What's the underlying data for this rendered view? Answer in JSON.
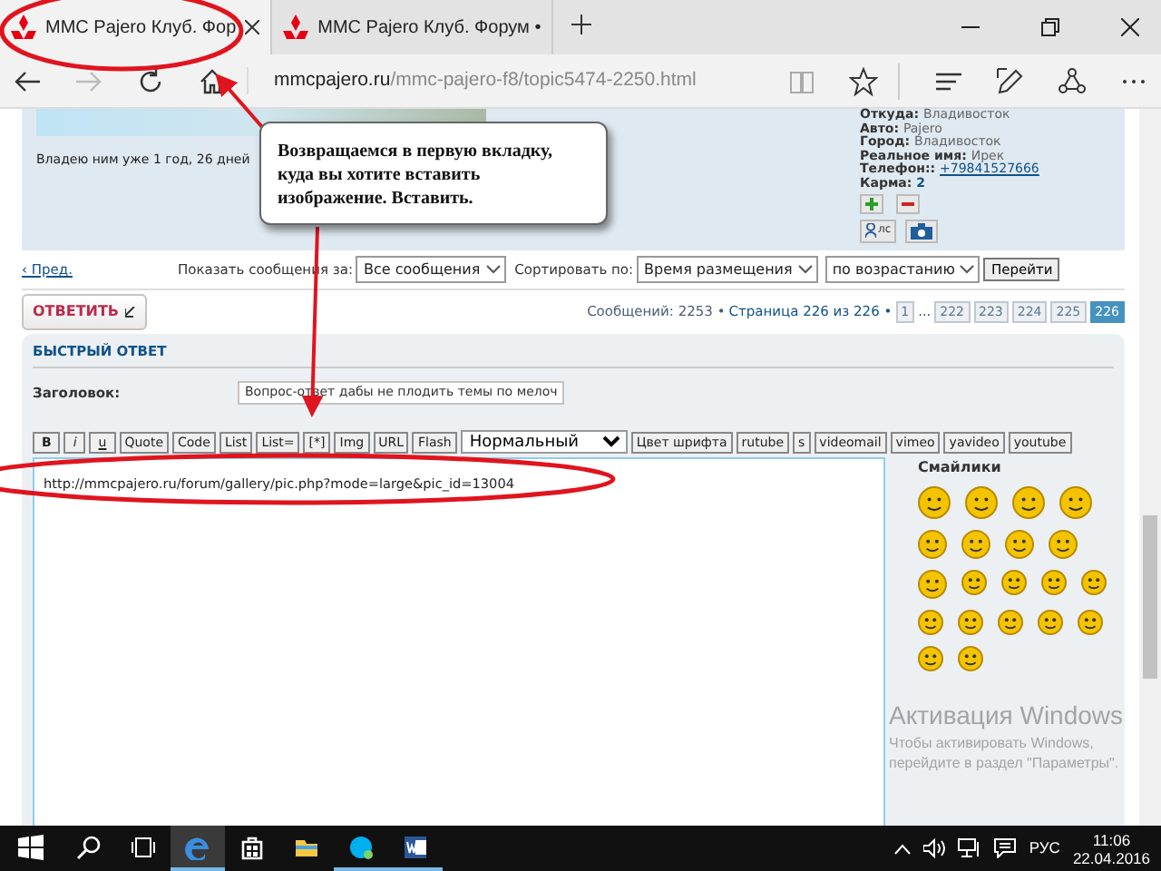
{
  "browser": {
    "tabs": [
      {
        "title": "MMC Pajero Клуб. Фор",
        "selected": true
      },
      {
        "title": "MMC Pajero Клуб. Форум •",
        "selected": false
      }
    ],
    "address": {
      "domain": "mmcpajero.ru",
      "path": "/mmc-pajero-f8/topic5474-2250.html"
    },
    "forward_disabled": true
  },
  "profile": {
    "ownership": "Владею ним уже 1 год, 26 дней",
    "fields": [
      {
        "label": "Откуда:",
        "value": "Владивосток",
        "kind": "text"
      },
      {
        "label": "Авто:",
        "value": "Pajero",
        "kind": "text"
      },
      {
        "label": "Город:",
        "value": "Владивосток",
        "kind": "text"
      },
      {
        "label": "Реальное имя:",
        "value": "Ирек",
        "kind": "text"
      },
      {
        "label": "Телефон::",
        "value": "+79841527666",
        "kind": "link"
      },
      {
        "label": "Карма:",
        "value": "2",
        "kind": "number"
      }
    ],
    "pm_label": "лс"
  },
  "callout": {
    "text": "Возвращаемся в первую вкладку, куда вы хотите вставить изображение. Вставить."
  },
  "display_bar": {
    "prev": "‹ Пред.",
    "show_label": "Показать сообщения за:",
    "show_value": "Все сообщения",
    "sort_label": "Сортировать по:",
    "sort_value": "Время размещения",
    "order_value": "по возрастанию",
    "go": "Перейти"
  },
  "reply_button": "ОТВЕТИТЬ",
  "pagination": {
    "summary": "Сообщений: 2253 •",
    "page_info": "Страница 226 из 226 •",
    "pages": [
      {
        "label": "1",
        "kind": "page",
        "selected": false
      },
      {
        "label": "…",
        "kind": "gap"
      },
      {
        "label": "222",
        "kind": "page",
        "selected": false
      },
      {
        "label": "223",
        "kind": "page",
        "selected": false
      },
      {
        "label": "224",
        "kind": "page",
        "selected": false
      },
      {
        "label": "225",
        "kind": "page",
        "selected": false
      },
      {
        "label": "226",
        "kind": "page",
        "selected": true
      }
    ]
  },
  "quick_reply": {
    "title": "БЫСТРЫЙ ОТВЕТ",
    "subject_label": "Заголовок:",
    "subject_value": "Вопрос-ответ дабы не плодить темы по мелоч",
    "toolbar": [
      {
        "label": "B",
        "kind": "bold"
      },
      {
        "label": "i",
        "kind": "italic"
      },
      {
        "label": "u",
        "kind": "underline"
      },
      {
        "label": "Quote",
        "kind": "plain"
      },
      {
        "label": "Code",
        "kind": "plain"
      },
      {
        "label": "List",
        "kind": "plain"
      },
      {
        "label": "List=",
        "kind": "plain"
      },
      {
        "label": "[*]",
        "kind": "plain"
      },
      {
        "label": "Img",
        "kind": "plain"
      },
      {
        "label": "URL",
        "kind": "plain"
      },
      {
        "label": "Flash",
        "kind": "plain"
      }
    ],
    "size_select": "Нормальный",
    "extra_buttons": [
      "Цвет шрифта",
      "rutube",
      "s",
      "videomail",
      "vimeo",
      "yavideo",
      "youtube"
    ],
    "message": "http://mmcpajero.ru/forum/gallery/pic.php?mode=large&pic_id=13004",
    "smilies_title": "Смайлики"
  },
  "activation": {
    "title": "Активация Windows",
    "text": "Чтобы активировать Windows, перейдите в раздел \"Параметры\"."
  },
  "taskbar": {
    "apps": [
      {
        "kind": "edge",
        "running": true,
        "active": true
      },
      {
        "kind": "store",
        "running": false,
        "active": false
      },
      {
        "kind": "explorer",
        "running": false,
        "active": false
      },
      {
        "kind": "skype",
        "running": true,
        "active": false
      },
      {
        "kind": "word",
        "running": true,
        "active": false
      }
    ],
    "language": "РУС",
    "time": "11:06",
    "date": "22.04.2016"
  }
}
